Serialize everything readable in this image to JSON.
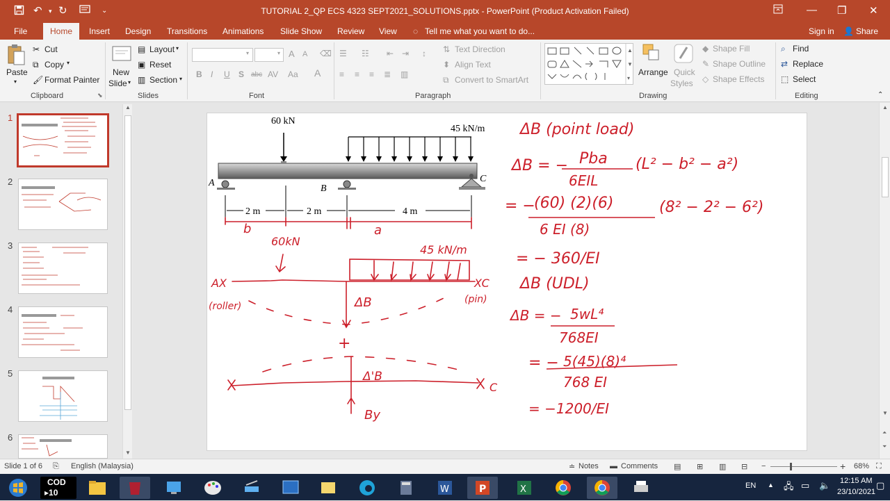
{
  "window": {
    "title": "TUTORIAL 2_QP ECS 4323 SEPT2021_SOLUTIONS.pptx - PowerPoint (Product Activation Failed)"
  },
  "tabs": [
    "File",
    "Home",
    "Insert",
    "Design",
    "Transitions",
    "Animations",
    "Slide Show",
    "Review",
    "View"
  ],
  "tell_me": "Tell me what you want to do...",
  "account": {
    "signin": "Sign in",
    "share": "Share"
  },
  "ribbon": {
    "clipboard": {
      "paste": "Paste",
      "cut": "Cut",
      "copy": "Copy",
      "format_painter": "Format Painter",
      "label": "Clipboard"
    },
    "slides": {
      "new_slide_1": "New",
      "new_slide_2": "Slide",
      "layout": "Layout",
      "reset": "Reset",
      "section": "Section",
      "label": "Slides"
    },
    "font": {
      "bold": "B",
      "italic": "I",
      "underline": "U",
      "shadow": "S",
      "strike": "abc",
      "spacing": "AV",
      "case": "Aa",
      "color": "A",
      "grow": "A",
      "shrink": "A",
      "label": "Font"
    },
    "paragraph": {
      "text_direction": "Text Direction",
      "align_text": "Align Text",
      "smartart": "Convert to SmartArt",
      "label": "Paragraph"
    },
    "drawing": {
      "arrange": "Arrange",
      "quick_styles_1": "Quick",
      "quick_styles_2": "Styles",
      "shape_fill": "Shape Fill",
      "shape_outline": "Shape Outline",
      "shape_effects": "Shape Effects",
      "label": "Drawing"
    },
    "editing": {
      "find": "Find",
      "replace": "Replace",
      "select": "Select",
      "label": "Editing"
    }
  },
  "thumbnails": [
    "1",
    "2",
    "3",
    "4",
    "5",
    "6"
  ],
  "slide": {
    "load_point": "60 kN",
    "load_udl": "45 kN/m",
    "support_a": "A",
    "support_b": "B",
    "support_c": "C",
    "dim_1": "2 m",
    "dim_2": "2 m",
    "dim_3": "4 m",
    "hw_b": "b",
    "hw_a": "a",
    "hw_60kn": "60kN",
    "hw_45kn": "45 kN/m",
    "hw_ax": "AX",
    "hw_roller": "(roller)",
    "hw_xc": "XC",
    "hw_pin": "(pin)",
    "hw_delta_b": "ΔB",
    "hw_plus": "+",
    "hw_delta_b2": "Δ'B",
    "hw_by": "By",
    "hw_c2": "C",
    "eq_title1": "ΔB (point load)",
    "eq_db1_lhs": "ΔB = −",
    "eq_db1_num": "Pba",
    "eq_db1_den": "6EIL",
    "eq_db1_rhs": "(L² − b² − a²)",
    "eq_sub_lhs": "= −",
    "eq_sub_num": "(60)  (2)(6)",
    "eq_sub_den": "6 EI (8)",
    "eq_sub_rhs": "(8² − 2² − 6²)",
    "eq_res1": "= − 360/EI",
    "eq_title2": "ΔB (UDL)",
    "eq_db2_lhs": "ΔB = −",
    "eq_db2_num": "5wL⁴",
    "eq_db2_den": "768EI",
    "eq_sub2_lhs": "= −",
    "eq_sub2_num": "5(45)(8)⁴",
    "eq_sub2_den": "768 EI",
    "eq_res2": "= −1200/EI"
  },
  "status": {
    "slide_of": "Slide 1 of 6",
    "language": "English (Malaysia)",
    "notes": "Notes",
    "comments": "Comments",
    "zoom": "68%"
  },
  "taskbar": {
    "cod_line1": "COD",
    "cod_line2": "10",
    "lang": "EN",
    "time": "12:15 AM",
    "date": "23/10/2021"
  },
  "colors": {
    "accent": "#b7472a",
    "ink": "#cc1f2a"
  }
}
